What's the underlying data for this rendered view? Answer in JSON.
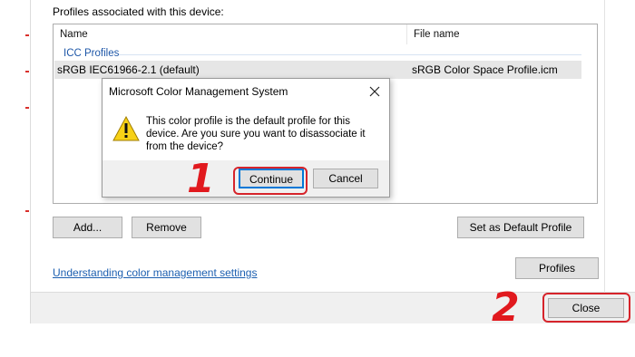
{
  "profiles_section": {
    "heading": "Profiles associated with this device:",
    "columns": [
      "Name",
      "File name"
    ],
    "group_label": "ICC Profiles",
    "rows": [
      {
        "name": "sRGB IEC61966-2.1 (default)",
        "file": "sRGB Color Space Profile.icm"
      }
    ]
  },
  "buttons": {
    "add": "Add...",
    "remove": "Remove",
    "set_default": "Set as Default Profile",
    "profiles": "Profiles",
    "close": "Close"
  },
  "link_text": "Understanding color management settings",
  "message_box": {
    "title": "Microsoft Color Management System",
    "message": "This color profile is the default profile for this device. Are you sure you want to disassociate it from the device?",
    "continue_label": "Continue",
    "cancel_label": "Cancel",
    "icon": "warning-icon"
  },
  "annotations": {
    "step1": "1",
    "step2": "2"
  },
  "colors": {
    "highlight": "#d6242b",
    "annotation_number": "#e1191e",
    "link": "#1c5fb0",
    "group_header": "#1e57a8"
  }
}
